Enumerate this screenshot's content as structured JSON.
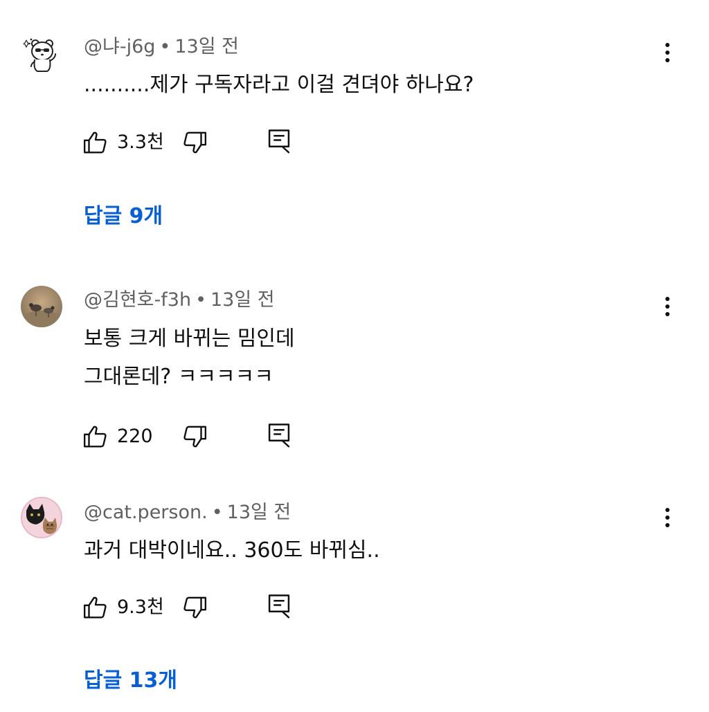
{
  "comments": [
    {
      "author": "@냐-j6g",
      "time": "13일 전",
      "lines": [
        "..........제가 구독자라고 이걸 견뎌야 하나요?"
      ],
      "likes": "3.3천",
      "replies": "답글 9개"
    },
    {
      "author": "@김현호-f3h",
      "time": "13일 전",
      "lines": [
        "보통 크게 바뀌는 밈인데",
        "그대론데? ㅋㅋㅋㅋㅋ"
      ],
      "likes": "220"
    },
    {
      "author": "@cat.person.",
      "time": "13일 전",
      "lines": [
        "과거 대박이네요.. 360도 바뀌심.."
      ],
      "likes": "9.3천",
      "replies": "답글 13개"
    }
  ],
  "separator": "•",
  "icons": {
    "like": "thumb-up-icon",
    "dislike": "thumb-down-icon",
    "reply": "comment-reply-icon",
    "more": "more-vertical-icon"
  },
  "colors": {
    "text": "#0f0f0f",
    "meta": "#606060",
    "link": "#065fd4"
  }
}
